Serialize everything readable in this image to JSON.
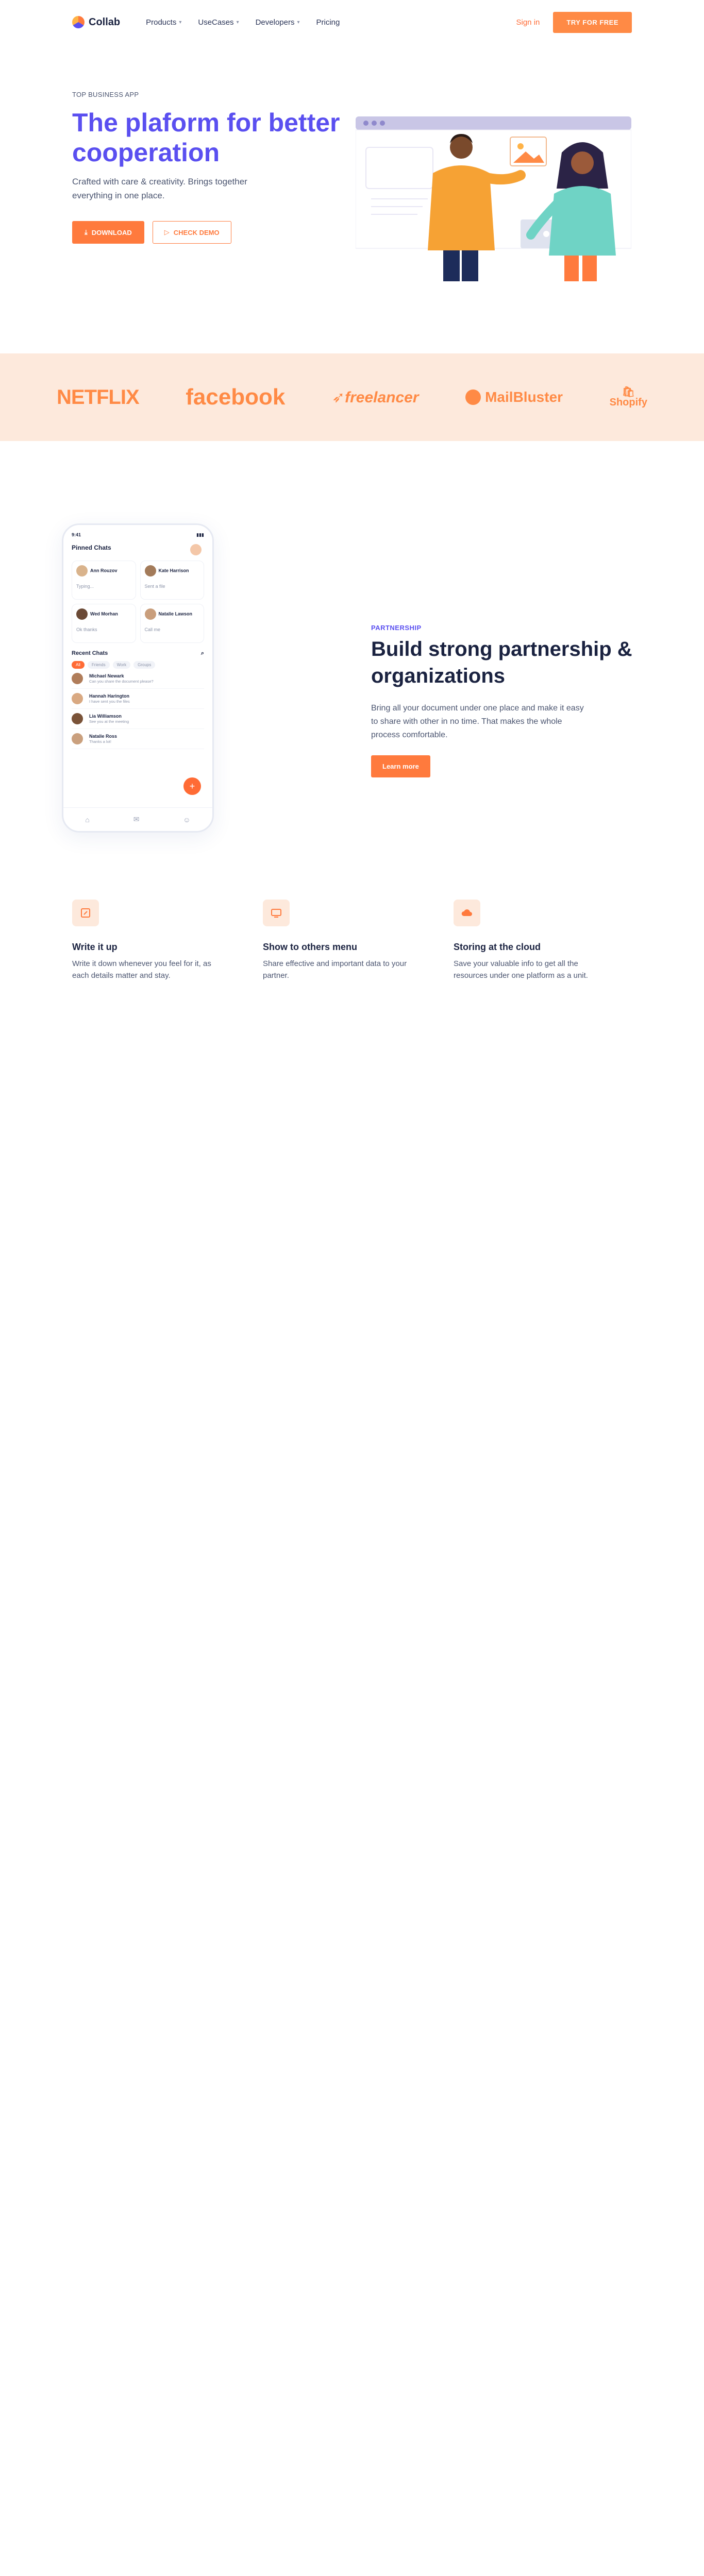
{
  "header": {
    "brand": "Collab",
    "nav": [
      {
        "label": "Products",
        "chevron": true
      },
      {
        "label": "UseCases",
        "chevron": true
      },
      {
        "label": "Developers",
        "chevron": true
      },
      {
        "label": "Pricing",
        "chevron": false
      }
    ],
    "signin": "Sign in",
    "cta": "TRY FOR FREE"
  },
  "hero": {
    "eyebrow": "TOP BUSINESS APP",
    "title": "The plaform for better cooperation",
    "subtitle": "Crafted with care & creativity. Brings together everything in one place.",
    "download": "DOWNLOAD",
    "demo": "CHECK DEMO"
  },
  "logos": {
    "netflix": "NETFLIX",
    "facebook": "facebook",
    "freelancer": "freelancer",
    "mailbluster": "MailBluster",
    "shop": "Shopify"
  },
  "partnership": {
    "kicker": "PARTNERSHIP",
    "title": "Build strong partnership & organizations",
    "body": "Bring all your document under one place and make it easy to share with other in no time. That makes the whole process comfortable.",
    "button": "Learn more",
    "phone": {
      "time": "9:41",
      "title": "Pinned Chats",
      "pinned": [
        {
          "name": "Ann Rouzov",
          "sub": "Typing..."
        },
        {
          "name": "Kate Harrison",
          "sub": "Sent a file"
        },
        {
          "name": "Wed Morhan",
          "sub": "Ok thanks"
        },
        {
          "name": "Natalie Lawson",
          "sub": "Call me"
        }
      ],
      "recent_title": "Recent Chats",
      "tabs": [
        "All",
        "Friends",
        "Work",
        "Groups"
      ],
      "chats": [
        {
          "name": "Michael Newark",
          "msg": "Can you share the document please?"
        },
        {
          "name": "Hannah Harington",
          "msg": "I have sent you the files"
        },
        {
          "name": "Lia Williamson",
          "msg": "See you at the meeting"
        },
        {
          "name": "Natalie Ross",
          "msg": "Thanks a lot!"
        }
      ]
    }
  },
  "features": [
    {
      "title": "Write it up",
      "body": "Write it down whenever you feel for it, as each details matter and stay."
    },
    {
      "title": "Show to others menu",
      "body": "Share effective and important data to your partner."
    },
    {
      "title": "Storing at the cloud",
      "body": "Save your valuable info to get all the resources under one platform as a unit."
    }
  ],
  "colors": {
    "accent": "#ff7a3d",
    "brand": "#5a4ff0",
    "tint": "#fde9dc"
  }
}
